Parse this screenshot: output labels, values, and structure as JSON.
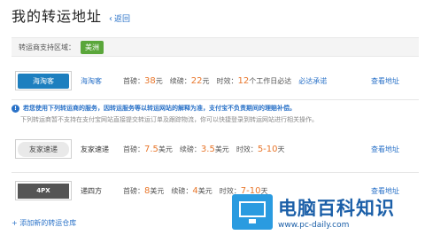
{
  "header": {
    "title": "我的转运地址",
    "back_label": "返回"
  },
  "region": {
    "label": "转运商支持区域：",
    "tag": "美洲"
  },
  "providers": [
    {
      "logo_text": "海淘客",
      "name": "海淘客",
      "first_weight_label": "首磅：",
      "first_weight": "38",
      "first_unit": "元",
      "extra_weight_label": "续磅：",
      "extra_weight": "22",
      "extra_unit": "元",
      "time_label": "时效：",
      "time": "12",
      "time_unit": "个工作日必达",
      "promise": "必达承诺",
      "view": "查看地址"
    },
    {
      "logo_text": "友家速递",
      "name": "友家速递",
      "first_weight_label": "首磅：",
      "first_weight": "7.5",
      "first_unit": "美元",
      "extra_weight_label": "续磅：",
      "extra_weight": "3.5",
      "extra_unit": "美元",
      "time_label": "时效：",
      "time": "5-10",
      "time_unit": "天",
      "view": "查看地址"
    },
    {
      "logo_text": "4PX",
      "name": "递四方",
      "first_weight_label": "首磅：",
      "first_weight": "8",
      "first_unit": "美元",
      "extra_weight_label": "续磅：",
      "extra_weight": "4",
      "extra_unit": "美元",
      "time_label": "时效：",
      "time": "7-10",
      "time_unit": "天",
      "view": "查看地址"
    }
  ],
  "notice": {
    "line1": "若您使用下列转运商的服务，因转运服务等以转运网站的解释为准，支付宝不负责期间的理赔补偿。",
    "line2": "下列转运商暂不支持在支付宝网站直接提交转运订单及跟踪物流，你可以快捷登录到转运网站进行相关操作。"
  },
  "footer": {
    "add_label": "+ 添加新的转运仓库"
  },
  "watermark": {
    "name": "电脑百科知识",
    "url": "www.pc-daily.com"
  }
}
